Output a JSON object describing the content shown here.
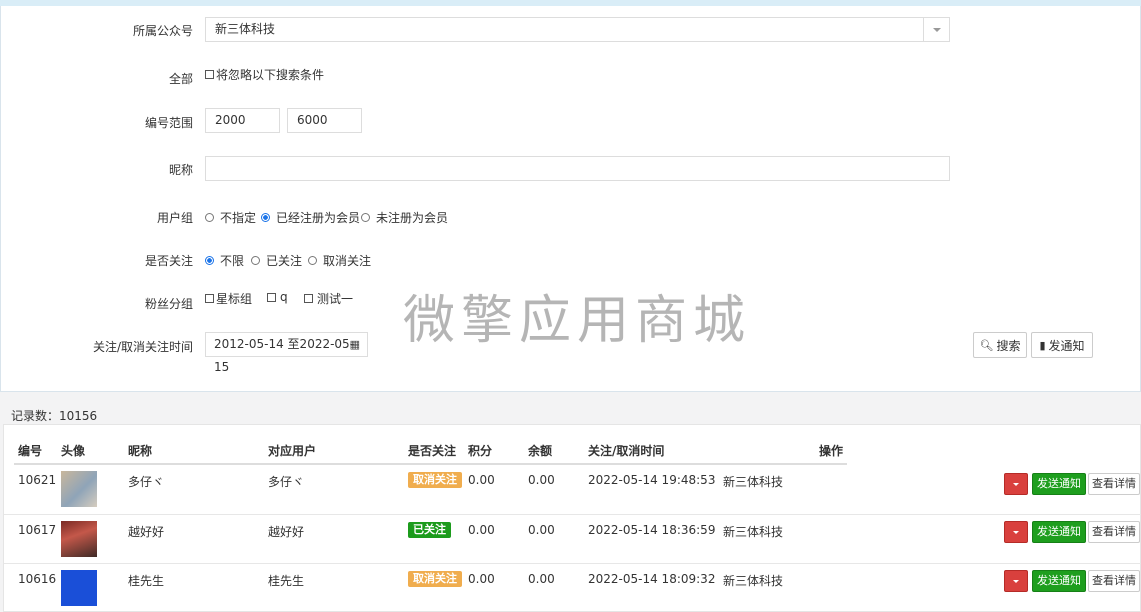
{
  "filters": {
    "account": {
      "label": "所属公众号",
      "value": "新三体科技"
    },
    "all": {
      "label": "全部",
      "option": "将忽略以下搜索条件"
    },
    "id_range": {
      "label": "编号范围",
      "from": "2000",
      "to": "6000"
    },
    "nickname": {
      "label": "昵称",
      "value": ""
    },
    "user_group": {
      "label": "用户组",
      "options": [
        "不指定",
        "已经注册为会员",
        "未注册为会员"
      ],
      "selected": "已经注册为会员"
    },
    "follow": {
      "label": "是否关注",
      "options": [
        "不限",
        "已关注",
        "取消关注"
      ],
      "selected": "不限"
    },
    "fan_group": {
      "label": "粉丝分组",
      "options": [
        "星标组",
        "q",
        "测试一"
      ]
    },
    "time": {
      "label": "关注/取消关注时间",
      "value": "2012-05-14 至2022-05-15"
    }
  },
  "watermark": "微擎应用商城",
  "actions": {
    "search": "搜索",
    "notify": "发通知"
  },
  "record_count": "记录数：10156",
  "table": {
    "headers": [
      "编号",
      "头像",
      "昵称",
      "对应用户",
      "是否关注",
      "积分",
      "余额",
      "关注/取消时间",
      "操作"
    ],
    "rows": [
      {
        "id": "10621",
        "nickname": "多仔ヾ",
        "user": "多仔ヾ",
        "status": "取消关注",
        "status_type": "warn",
        "points": "0.00",
        "balance": "0.00",
        "time": "2022-05-14 19:48:53",
        "account": "新三体科技"
      },
      {
        "id": "10617",
        "nickname": "越好好",
        "user": "越好好",
        "status": "已关注",
        "status_type": "ok",
        "points": "0.00",
        "balance": "0.00",
        "time": "2022-05-14 18:36:59",
        "account": "新三体科技"
      },
      {
        "id": "10616",
        "nickname": "桂先生",
        "user": "桂先生",
        "status": "取消关注",
        "status_type": "warn",
        "points": "0.00",
        "balance": "0.00",
        "time": "2022-05-14 18:09:32",
        "account": "新三体科技"
      }
    ],
    "row_actions": {
      "notify": "发送通知",
      "detail": "查看详情"
    }
  },
  "colors": {
    "warn": "#f0ad4e",
    "ok": "#1c9b1c",
    "danger": "#d9403d",
    "success": "#1e9e1e"
  }
}
